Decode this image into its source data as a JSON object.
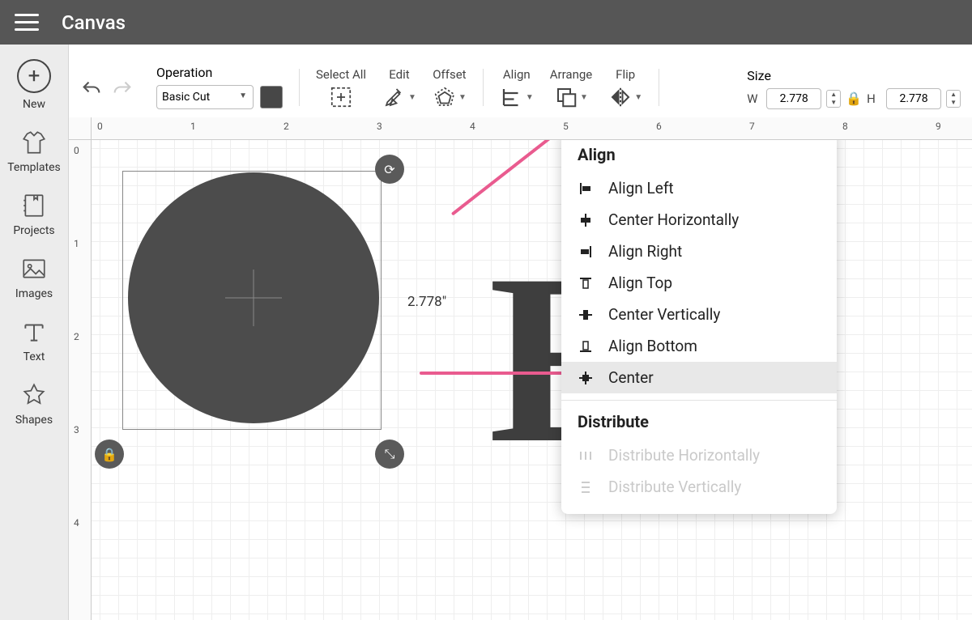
{
  "app": {
    "title": "Canvas"
  },
  "sidebar": {
    "items": [
      {
        "label": "New"
      },
      {
        "label": "Templates"
      },
      {
        "label": "Projects"
      },
      {
        "label": "Images"
      },
      {
        "label": "Text"
      },
      {
        "label": "Shapes"
      }
    ]
  },
  "toolbar": {
    "operation_label": "Operation",
    "operation_value": "Basic Cut",
    "select_all": "Select All",
    "edit": "Edit",
    "offset": "Offset",
    "align": "Align",
    "arrange": "Arrange",
    "flip": "Flip",
    "size": "Size"
  },
  "size": {
    "w_label": "W",
    "h_label": "H",
    "w_value": "2.778",
    "h_value": "2.778"
  },
  "canvas": {
    "dimension_label": "2.778\"",
    "ruler_h": [
      "0",
      "1",
      "2",
      "3",
      "4",
      "5",
      "6",
      "7",
      "8",
      "9"
    ],
    "ruler_v": [
      "0",
      "1",
      "2",
      "3",
      "4"
    ]
  },
  "dropdown": {
    "align_heading": "Align",
    "items": [
      {
        "label": "Align Left"
      },
      {
        "label": "Center Horizontally"
      },
      {
        "label": "Align Right"
      },
      {
        "label": "Align Top"
      },
      {
        "label": "Center Vertically"
      },
      {
        "label": "Align Bottom"
      },
      {
        "label": "Center"
      }
    ],
    "distribute_heading": "Distribute",
    "distribute_items": [
      {
        "label": "Distribute Horizontally"
      },
      {
        "label": "Distribute Vertically"
      }
    ]
  }
}
